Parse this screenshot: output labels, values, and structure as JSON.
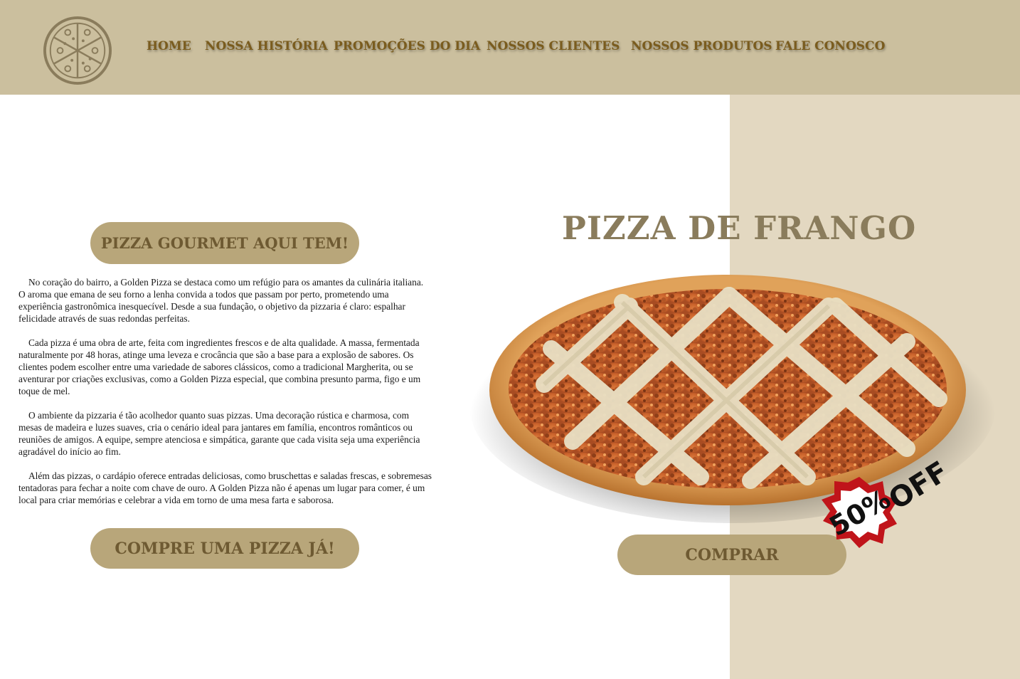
{
  "header": {
    "logo": "pizza-logo-icon",
    "nav": [
      "HOME",
      "NOSSA HISTÓRIA",
      "PROMOÇÕES DO DIA",
      "NOSSOS CLIENTES",
      "NOSSOS PRODUTOS",
      "FALE CONOSCO"
    ]
  },
  "left": {
    "headline_button": "PIZZA GOURMET AQUI TEM!",
    "paragraphs": [
      "No coração do bairro, a Golden Pizza se destaca como um refúgio para os amantes da culinária italiana. O aroma que emana de seu forno a lenha convida a todos que passam por perto, prometendo uma experiência gastronômica inesquecível. Desde a sua fundação, o objetivo da pizzaria é claro: espalhar felicidade através de suas redondas perfeitas.",
      "Cada pizza é uma obra de arte, feita com ingredientes frescos e de alta qualidade. A massa, fermentada naturalmente por 48 horas, atinge uma leveza e crocância que são a base para a explosão de sabores. Os clientes podem escolher entre uma variedade de sabores clássicos, como a tradicional Margherita, ou se aventurar por criações exclusivas, como a Golden Pizza especial, que combina presunto parma, figo e um toque de mel.",
      "O ambiente da pizzaria é tão acolhedor quanto suas pizzas. Uma decoração rústica e charmosa, com mesas de madeira e luzes suaves, cria o cenário ideal para jantares em família, encontros românticos ou reuniões de amigos. A equipe, sempre atenciosa e simpática, garante que cada visita seja uma experiência agradável do início ao fim.",
      "Além das pizzas, o cardápio oferece entradas deliciosas, como bruschettas e saladas frescas, e sobremesas tentadoras para fechar a noite com chave de ouro. A Golden Pizza não é apenas um lugar para comer, é um local para criar memórias e celebrar a vida em torno de uma mesa farta e saborosa."
    ],
    "cta_button": "COMPRE UMA PIZZA JÁ!"
  },
  "product": {
    "title": "PIZZA DE FRANGO",
    "image": "chicken-pizza-image",
    "badge_percent": "50%",
    "badge_off": "OFF",
    "buy_button": "COMPRAR"
  },
  "colors": {
    "header_bg": "#cbbf9e",
    "panel_bg": "#e3d8c1",
    "button_bg": "#b8a67a",
    "nav_text": "#7a5c1e",
    "badge_red": "#c0141a"
  }
}
